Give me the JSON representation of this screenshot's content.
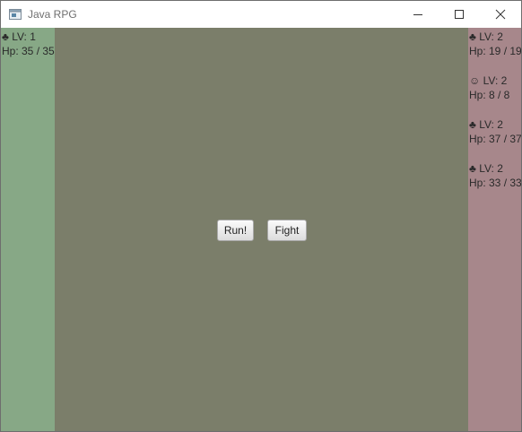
{
  "window": {
    "title": "Java RPG",
    "controls": [
      "minimize-icon",
      "maximize-icon",
      "close-icon"
    ]
  },
  "player_panel": {
    "color": "#87a886",
    "units": [
      {
        "icon": "♣",
        "level": "LV: 1",
        "hp": "Hp: 35 / 35"
      }
    ]
  },
  "arena": {
    "color": "#7b7e6a",
    "run_label": "Run!",
    "fight_label": "Fight"
  },
  "enemy_panel": {
    "color": "#a7878b",
    "units": [
      {
        "icon": "♣",
        "level": "LV: 2",
        "hp": "Hp: 19 / 19"
      },
      {
        "icon": "☺",
        "level": "LV: 2",
        "hp": "Hp: 8 / 8"
      },
      {
        "icon": "♣",
        "level": "LV: 2",
        "hp": "Hp: 37 / 37"
      },
      {
        "icon": "♣",
        "level": "LV: 2",
        "hp": "Hp: 33 / 33"
      }
    ]
  }
}
